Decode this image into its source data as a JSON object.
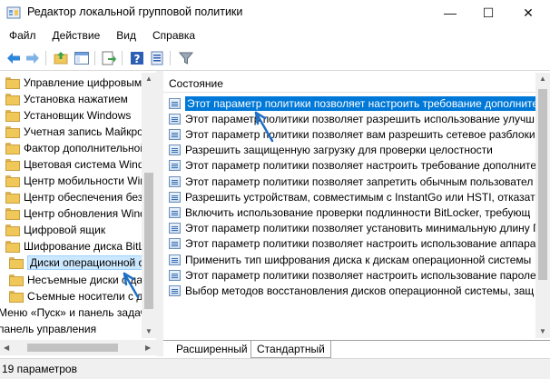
{
  "window": {
    "title": "Редактор локальной групповой политики",
    "minimize_glyph": "—",
    "maximize_glyph": "☐",
    "close_glyph": "✕"
  },
  "menu": [
    "Файл",
    "Действие",
    "Вид",
    "Справка"
  ],
  "toolbar": {
    "icons": [
      "back-arrow-icon",
      "forward-arrow-icon",
      "up-folder-icon",
      "show-hide-tree-icon",
      "export-list-icon",
      "help-icon",
      "properties-icon",
      "filter-icon"
    ]
  },
  "tree": {
    "items": [
      "Управление цифровыми п",
      "Установка нажатием",
      "Установщик Windows",
      "Учетная запись Майкросо",
      "Фактор дополнительной п",
      "Цветовая система Window",
      "Центр мобильности Windo",
      "Центр обеспечения безоп",
      "Центр обновления Window",
      "Цифровой ящик",
      "Шифрование диска BitLock",
      "Диски операционной с",
      "Несъемные диски с дан",
      "Съемные носители с д",
      "Меню «Пуск» и панель задач",
      "панель управления"
    ],
    "selected_index": 11
  },
  "right": {
    "column_header": "Состояние",
    "rows": [
      "Этот параметр политики позволяет настроить требование дополните",
      "Этот параметр политики позволяет разрешить использование улучш",
      "Этот параметр политики позволяет вам разрешить сетевое разблокир",
      "Разрешить защищенную загрузку для проверки целостности",
      "Этот параметр политики позволяет настроить требование дополните",
      "Этот параметр политики позволяет запретить обычным пользовател",
      "Разрешить устройствам, совместимым с InstantGo или HSTI, отказать",
      "Включить использование проверки подлинности BitLocker, требующ",
      "Этот параметр политики позволяет установить минимальную длину П",
      "Этот параметр политики позволяет настроить использование аппарат",
      "Применить тип шифрования диска к дискам операционной системы",
      "Этот параметр политики позволяет настроить использование пароле",
      "Выбор методов восстановления дисков операционной системы, защ"
    ],
    "selected_index": 0
  },
  "tabs": [
    "Расширенный",
    "Стандартный"
  ],
  "active_tab": 1,
  "status": "19 параметров",
  "colors": {
    "selection": "#0078d7",
    "tree_selection": "#cce8ff",
    "arrow": "#1f6fc5"
  }
}
